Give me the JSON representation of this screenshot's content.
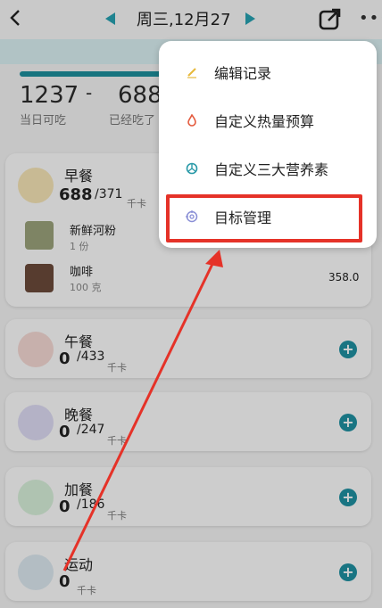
{
  "header": {
    "date": "周三,12月27",
    "back_icon": "back-chevron-icon",
    "prev_icon": "triangle-left-icon",
    "next_icon": "triangle-right-icon",
    "share_icon": "share-icon",
    "more_icon": "more-dots-icon"
  },
  "summary": {
    "can_eat_value": "1237",
    "can_eat_label": "当日可吃",
    "minus": "-",
    "eaten_value": "688",
    "eaten_label": "已经吃了"
  },
  "meals": [
    {
      "title": "早餐",
      "kcal": "688",
      "target": "/371",
      "unit": "千卡",
      "foods": [
        {
          "name": "新鲜河粉",
          "amount": "1 份",
          "value": ""
        },
        {
          "name": "咖啡",
          "amount": "100 克",
          "value": "358.0"
        }
      ]
    },
    {
      "title": "午餐",
      "kcal": "0",
      "target": "/433",
      "unit": "千卡",
      "add": "+"
    },
    {
      "title": "晚餐",
      "kcal": "0",
      "target": "/247",
      "unit": "千卡",
      "add": "+"
    },
    {
      "title": "加餐",
      "kcal": "0",
      "target": "/186",
      "unit": "千卡",
      "add": "+"
    },
    {
      "title": "运动",
      "kcal": "0",
      "target": "",
      "unit": "千卡",
      "add": "+"
    }
  ],
  "menu": {
    "items": [
      {
        "label": "编辑记录",
        "icon": "pencil-icon"
      },
      {
        "label": "自定义热量预算",
        "icon": "flame-icon"
      },
      {
        "label": "自定义三大营养素",
        "icon": "peace-icon"
      },
      {
        "label": "目标管理",
        "icon": "target-icon"
      }
    ]
  },
  "colors": {
    "accent": "#1f8fa0",
    "annotation": "#e53228"
  }
}
